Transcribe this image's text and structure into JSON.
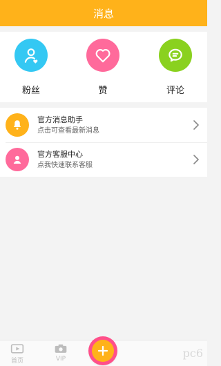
{
  "header": {
    "title": "消息"
  },
  "quick_actions": [
    {
      "label": "粉丝",
      "icon": "user-heart-icon",
      "color": "#34c8f3"
    },
    {
      "label": "赞",
      "icon": "heart-icon",
      "color": "#ff6a9b"
    },
    {
      "label": "评论",
      "icon": "chat-bubble-icon",
      "color": "#8ad11f"
    }
  ],
  "list": [
    {
      "title": "官方消息助手",
      "subtitle": "点击可查看最新消息",
      "icon": "bell-icon",
      "color": "#ffb21a"
    },
    {
      "title": "官方客服中心",
      "subtitle": "点我快速联系客服",
      "icon": "user-icon",
      "color": "#ff6a9b"
    }
  ],
  "tabbar": {
    "home_label": "首页",
    "vip_label": "VIP",
    "fab_icon": "plus-icon",
    "colors": {
      "fab_outer": "#ff4f8a",
      "fab_inner": "#ffb21a"
    }
  },
  "watermark": {
    "text": "pc6"
  },
  "colors": {
    "brand": "#ffb21a",
    "background": "#f3f3f3"
  }
}
